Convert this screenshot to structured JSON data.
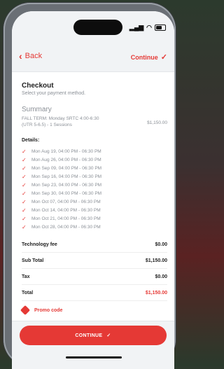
{
  "nav": {
    "back_label": "Back",
    "continue_label": "Continue"
  },
  "checkout": {
    "title": "Checkout",
    "subtitle": "Select your payment method."
  },
  "summary": {
    "title": "Summary",
    "line1": "FALL TERM: Monday SRTC 4:00-6:30",
    "line2": "(UTR 5-6.5) - 1 Sessions",
    "amount": "$1,150.00"
  },
  "details": {
    "title": "Details:",
    "sessions": [
      "Mon Aug 19, 04:00 PM - 06:30 PM",
      "Mon Aug 26, 04:00 PM - 06:30 PM",
      "Mon Sep 09, 04:00 PM - 06:30 PM",
      "Mon Sep 16, 04:00 PM - 06:30 PM",
      "Mon Sep 23, 04:00 PM - 06:30 PM",
      "Mon Sep 30, 04:00 PM - 06:30 PM",
      "Mon Oct 07, 04:00 PM - 06:30 PM",
      "Mon Oct 14, 04:00 PM - 06:30 PM",
      "Mon Oct 21, 04:00 PM - 06:30 PM",
      "Mon Oct 28, 04:00 PM - 06:30 PM"
    ]
  },
  "fees": {
    "technology_label": "Technology fee",
    "technology_value": "$0.00",
    "subtotal_label": "Sub Total",
    "subtotal_value": "$1,150.00",
    "tax_label": "Tax",
    "tax_value": "$0.00",
    "total_label": "Total",
    "total_value": "$1,150.00"
  },
  "promo": {
    "label": "Promo code"
  },
  "footer": {
    "continue_button": "CONTINUE"
  },
  "colors": {
    "accent": "#e53935",
    "muted": "#8a8f96",
    "surface": "#f1f3f5"
  }
}
